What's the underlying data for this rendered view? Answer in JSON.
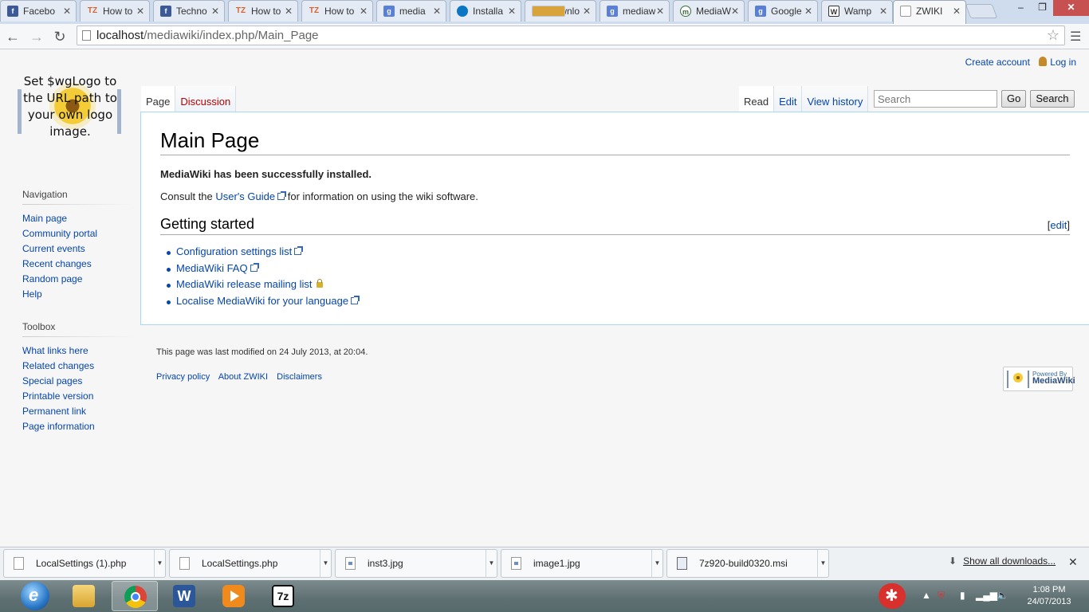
{
  "browser": {
    "tabs": [
      {
        "icon": "facebook-icon",
        "title": "Facebo",
        "active": false
      },
      {
        "icon": "tz-icon",
        "title": "How to",
        "active": false
      },
      {
        "icon": "facebook-icon",
        "title": "Techno",
        "active": false
      },
      {
        "icon": "tz-icon",
        "title": "How to",
        "active": false
      },
      {
        "icon": "tz-icon",
        "title": "How to",
        "active": false
      },
      {
        "icon": "google-icon",
        "title": "media",
        "active": false
      },
      {
        "icon": "drupal-icon",
        "title": "Installa",
        "active": false
      },
      {
        "icon": "download-icon",
        "title": "Downlo",
        "active": false
      },
      {
        "icon": "google-icon",
        "title": "mediaw",
        "active": false
      },
      {
        "icon": "mediawiki-icon",
        "title": "MediaW",
        "active": false
      },
      {
        "icon": "google-icon",
        "title": "Google",
        "active": false
      },
      {
        "icon": "wamp-icon",
        "title": "Wamp",
        "active": false
      },
      {
        "icon": "page-icon",
        "title": "ZWIKI",
        "active": true
      }
    ],
    "url_host": "localhost",
    "url_path": "/mediawiki/index.php/Main_Page"
  },
  "wiki": {
    "personal": {
      "create_account": "Create account",
      "log_in": "Log in"
    },
    "logo_text": "Set $wgLogo to the URL path to your own logo image.",
    "nav_heading": "Navigation",
    "nav_items": [
      "Main page",
      "Community portal",
      "Current events",
      "Recent changes",
      "Random page",
      "Help"
    ],
    "toolbox_heading": "Toolbox",
    "toolbox_items": [
      "What links here",
      "Related changes",
      "Special pages",
      "Printable version",
      "Permanent link",
      "Page information"
    ],
    "tabs_left": [
      "Page",
      "Discussion"
    ],
    "tabs_right": [
      "Read",
      "Edit",
      "View history"
    ],
    "search": {
      "placeholder": "Search",
      "go": "Go",
      "search": "Search"
    },
    "title": "Main Page",
    "installed": "MediaWiki has been successfully installed.",
    "consult_pre": "Consult the ",
    "consult_link": "User's Guide",
    "consult_post": " for information on using the wiki software.",
    "section_title": "Getting started",
    "section_edit": "edit",
    "steps": [
      "Configuration settings list",
      "MediaWiki FAQ",
      "MediaWiki release mailing list",
      "Localise MediaWiki for your language"
    ],
    "last_modified": "This page was last modified on 24 July 2013, at 20:04.",
    "footer_links": [
      "Privacy policy",
      "About ZWIKI",
      "Disclaimers"
    ],
    "powered_by_small": "Powered By",
    "powered_by_big": "MediaWiki"
  },
  "downloads": {
    "items": [
      "LocalSettings (1).php",
      "LocalSettings.php",
      "inst3.jpg",
      "image1.jpg",
      "7z920-build0320.msi"
    ],
    "show_all": "Show all downloads..."
  },
  "taskbar": {
    "apps": [
      "file-explorer-icon",
      "chrome-icon",
      "word-icon",
      "media-player-icon",
      "7zip-icon"
    ],
    "time": "1:08 PM",
    "date": "24/07/2013"
  }
}
